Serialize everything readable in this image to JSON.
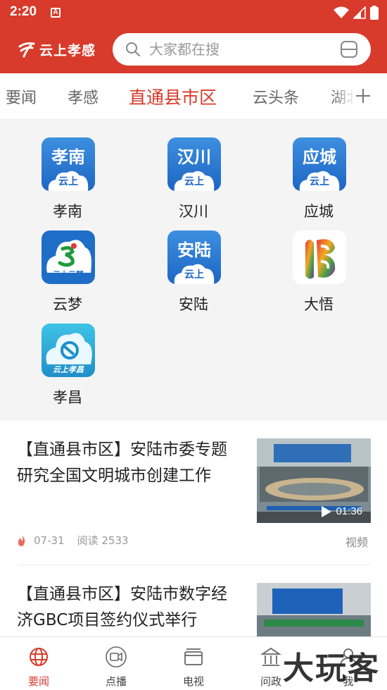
{
  "status_bar": {
    "time": "2:20",
    "notif": "A"
  },
  "header": {
    "brand": "云上孝感",
    "search": {
      "placeholder": "大家都在搜"
    }
  },
  "tabs": [
    {
      "label": "要闻"
    },
    {
      "label": "孝感"
    },
    {
      "label": "直通县市区",
      "active": true
    },
    {
      "label": "云头条"
    },
    {
      "label": "湖北"
    }
  ],
  "grid": [
    {
      "name": "孝南",
      "logo_text": "孝南",
      "cloud_text": "云上"
    },
    {
      "name": "汉川",
      "logo_text": "汉川",
      "cloud_text": "云上"
    },
    {
      "name": "应城",
      "logo_text": "应城",
      "cloud_text": "云上"
    },
    {
      "name": "云梦",
      "logo_text": "云上云梦"
    },
    {
      "name": "安陆",
      "logo_text": "安陆",
      "cloud_text": "云上"
    },
    {
      "name": "大悟"
    },
    {
      "name": "孝昌",
      "logo_text": "云上孝昌"
    }
  ],
  "news": [
    {
      "title": "【直通县市区】安陆市委专题研究全国文明城市创建工作",
      "date": "07-31",
      "reads": "阅读 2533",
      "tag": "视频",
      "duration": "01:36"
    },
    {
      "title": "【直通县市区】安陆市数字经济GBC项目签约仪式举行"
    }
  ],
  "bottom_nav": [
    {
      "label": "要闻",
      "active": true
    },
    {
      "label": "点播"
    },
    {
      "label": "电视"
    },
    {
      "label": "问政"
    },
    {
      "label": "我"
    }
  ],
  "watermark": "大玩客",
  "colors": {
    "accent": "#d83a2b"
  }
}
